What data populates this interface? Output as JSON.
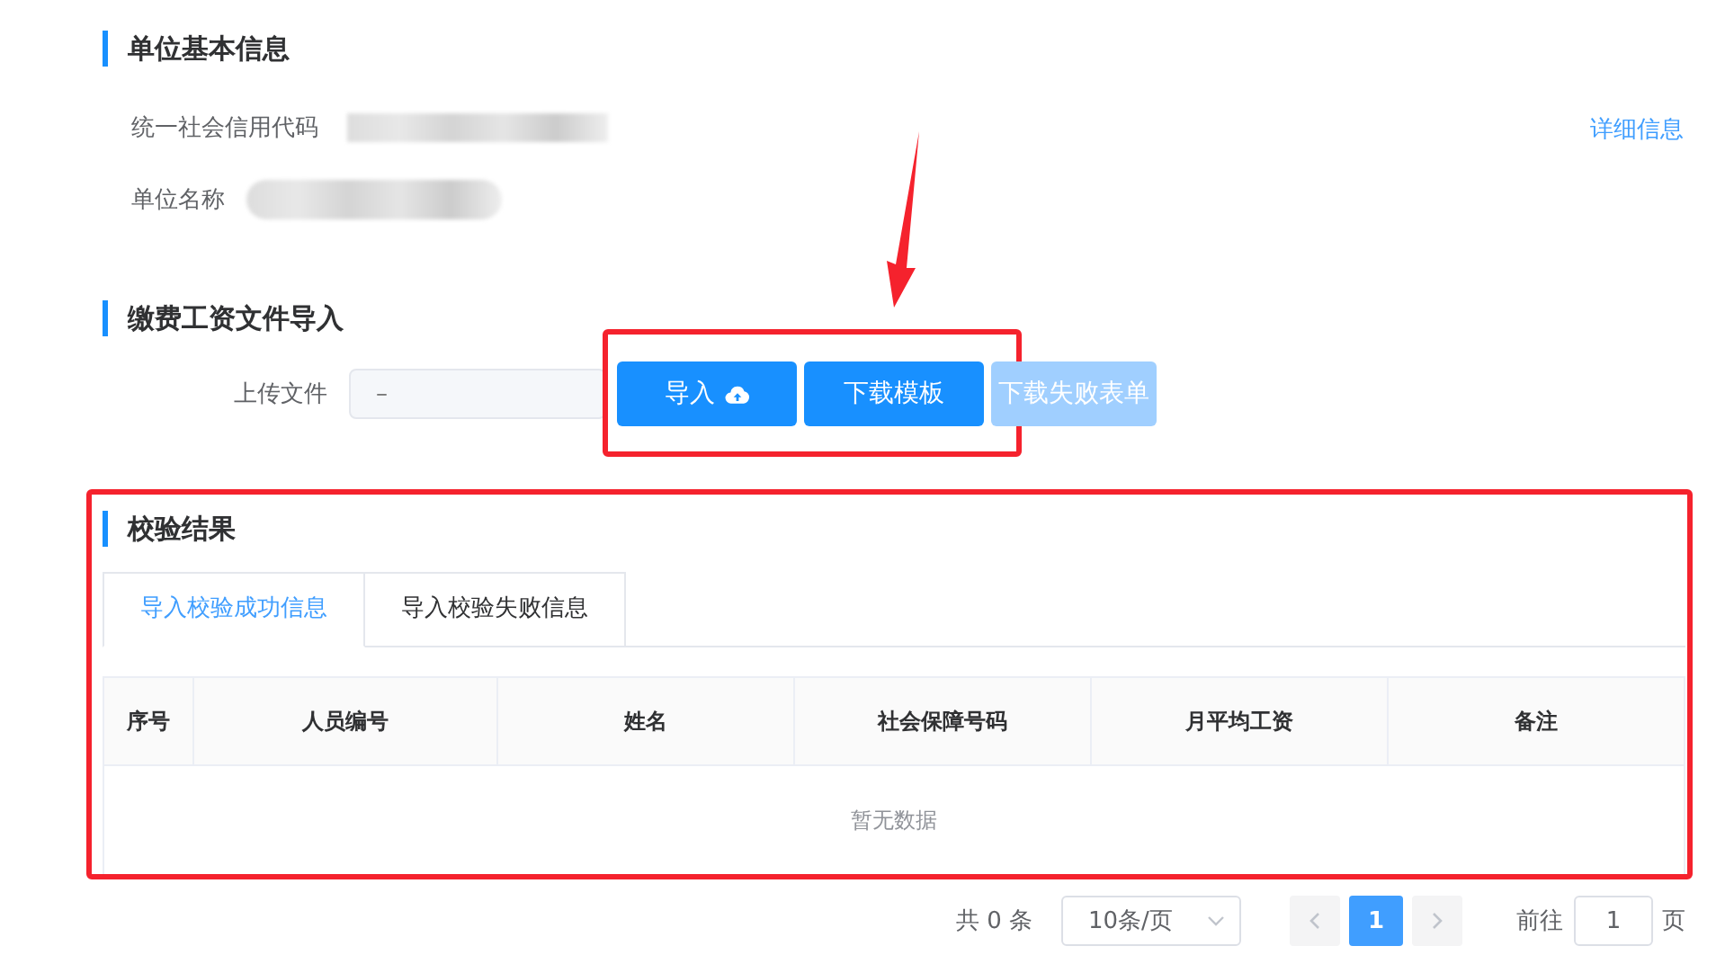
{
  "basic_info": {
    "title": "单位基本信息",
    "detail_link": "详细信息",
    "fields": [
      {
        "label": "统一社会信用代码"
      },
      {
        "label": "单位名称"
      }
    ]
  },
  "import_section": {
    "title": "缴费工资文件导入",
    "upload_label": "上传文件",
    "upload_placeholder": "–",
    "buttons": [
      {
        "label": "导入",
        "kind": "upload",
        "disabled": false
      },
      {
        "label": "下载模板",
        "kind": "plain",
        "disabled": false
      },
      {
        "label": "下载失败表单",
        "kind": "plain",
        "disabled": true
      }
    ]
  },
  "result_section": {
    "title": "校验结果",
    "tabs": [
      {
        "label": "导入校验成功信息",
        "selected": true
      },
      {
        "label": "导入校验失败信息",
        "selected": false
      }
    ],
    "table": {
      "columns": [
        "序号",
        "人员编号",
        "姓名",
        "社会保障号码",
        "月平均工资",
        "备注"
      ],
      "empty_text": "暂无数据"
    }
  },
  "pagination": {
    "total": "共 0 条",
    "page_size": "10条/页",
    "pages": [
      {
        "label": "1",
        "selected": true
      }
    ],
    "goto_label": "前往",
    "goto_value": "1",
    "page_unit": "页"
  }
}
